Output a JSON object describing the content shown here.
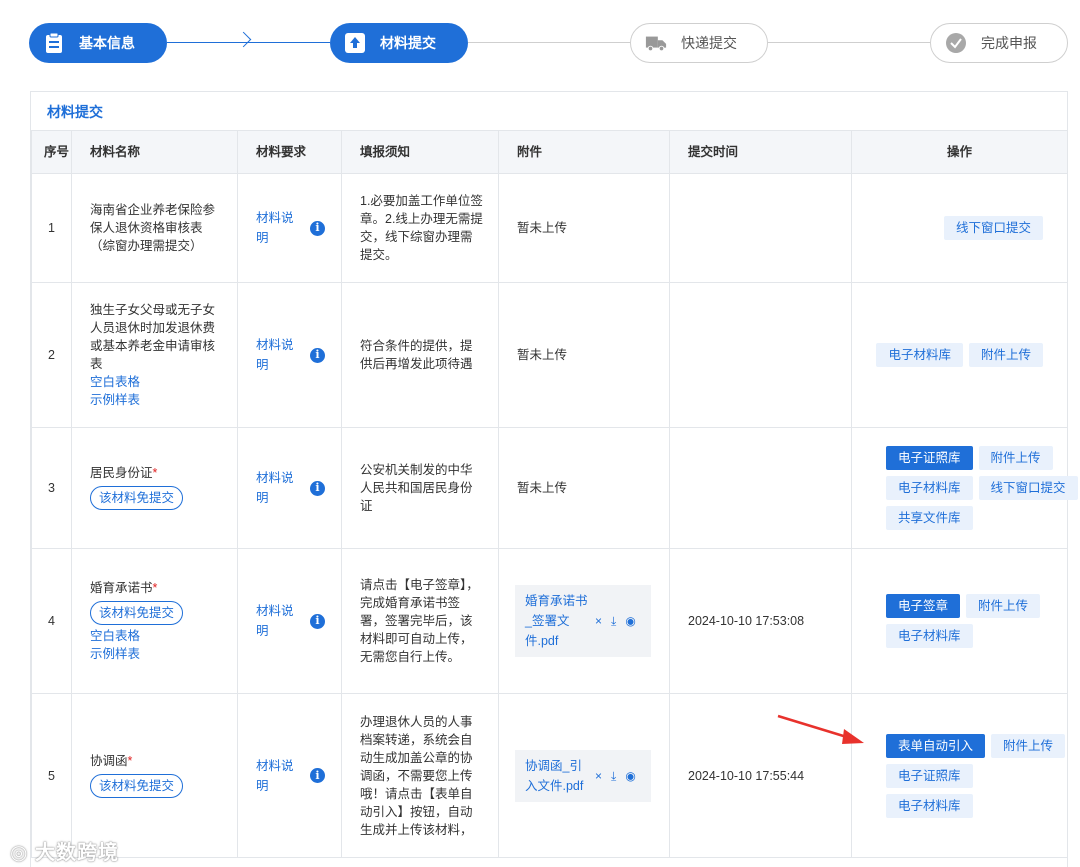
{
  "steps": [
    {
      "label": "基本信息",
      "state": "done",
      "icon": "clipboard-icon"
    },
    {
      "label": "材料提交",
      "state": "active",
      "icon": "upload-icon"
    },
    {
      "label": "快递提交",
      "state": "inactive",
      "icon": "truck-icon"
    },
    {
      "label": "完成申报",
      "state": "inactive",
      "icon": "check-circle-icon"
    }
  ],
  "panel": {
    "title": "材料提交"
  },
  "table": {
    "headers": [
      "序号",
      "材料名称",
      "材料要求",
      "填报须知",
      "附件",
      "提交时间",
      "操作"
    ],
    "rows": [
      {
        "index": "1",
        "name": "海南省企业养老保险参保人退休资格审核表（综窗办理需提交）",
        "requirement": "材料说明",
        "notice": "1.必要加盖工作单位签章。2.线上办理无需提交，线下综窗办理需提交。",
        "attachment": "暂未上传",
        "time": "",
        "actions": [
          "线下窗口提交"
        ]
      },
      {
        "index": "2",
        "name": "独生子女父母或无子女人员退休时加发退休费或基本养老金申请审核表",
        "links": [
          "空白表格",
          "示例样表"
        ],
        "requirement": "材料说明",
        "notice": "符合条件的提供，提供后再增发此项待遇",
        "attachment": "暂未上传",
        "time": "",
        "actions": [
          "电子材料库",
          "附件上传"
        ]
      },
      {
        "index": "3",
        "name": "居民身份证",
        "required_mark": "*",
        "tag": "该材料免提交",
        "requirement": "材料说明",
        "notice": "公安机关制发的中华人民共和国居民身份证",
        "attachment": "暂未上传",
        "time": "",
        "actions": [
          "电子证照库",
          "附件上传",
          "电子材料库",
          "线下窗口提交",
          "共享文件库"
        ]
      },
      {
        "index": "4",
        "name": "婚育承诺书",
        "required_mark": "*",
        "tag": "该材料免提交",
        "links": [
          "空白表格",
          "示例样表"
        ],
        "requirement": "材料说明",
        "notice": "请点击【电子签章】，完成婚育承诺书签署，签署完毕后，该材料即可自动上传，无需您自行上传。",
        "attachment": "婚育承诺书_签署文件.pdf",
        "time": "2024-10-10 17:53:08",
        "actions": [
          "电子签章",
          "附件上传",
          "电子材料库"
        ]
      },
      {
        "index": "5",
        "name": "协调函",
        "required_mark": "*",
        "tag": "该材料免提交",
        "requirement": "材料说明",
        "notice": "办理退休人员的人事档案转递，系统会自动生成加盖公章的协调函，不需要您上传哦！请点击【表单自动引入】按钮，自动生成并上传该材料，",
        "attachment": "协调函_引入文件.pdf",
        "time": "2024-10-10 17:55:44",
        "actions": [
          "表单自动引入",
          "附件上传",
          "电子证照库",
          "电子材料库"
        ]
      }
    ]
  },
  "file_actions": {
    "delete": "×",
    "download": "⤓",
    "preview": "◉"
  },
  "info_glyph": "i",
  "watermark": "大数跨境",
  "colors": {
    "primary": "#1f6fd8",
    "required": "#e02020",
    "arrow": "#e8322c"
  }
}
